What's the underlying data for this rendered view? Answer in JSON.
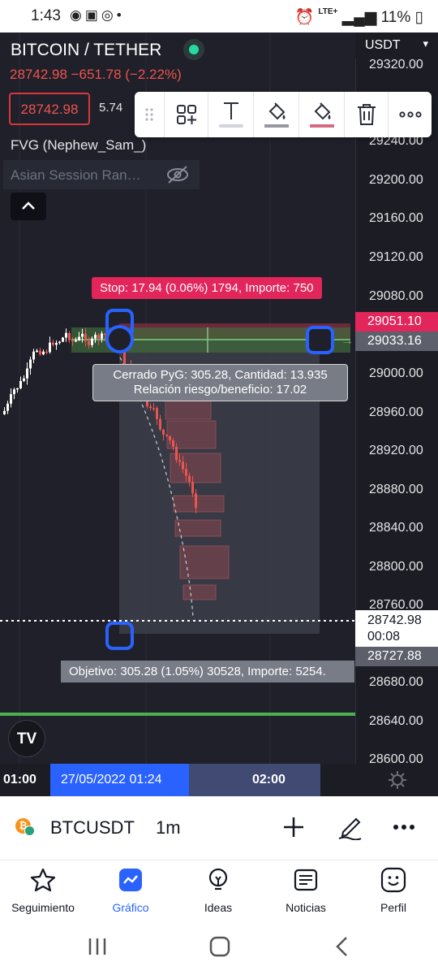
{
  "status_bar": {
    "time": "1:43",
    "network": "LTE+",
    "battery": "11%"
  },
  "chart": {
    "currency": "USDT",
    "pair_title": "BITCOIN / TETHER",
    "quote": "28742.98  −651.78 (−2.22%)",
    "sell_price": "28742.98",
    "spread": "5.74",
    "indicator_1": "FVG (Nephew_Sam_)",
    "indicator_2": "Asian Session Ran…",
    "price_ticks": [
      "29320.00",
      "29240.00",
      "29200.00",
      "29160.00",
      "29120.00",
      "29080.00",
      "29000.00",
      "28960.00",
      "28920.00",
      "28880.00",
      "28840.00",
      "28800.00",
      "28760.00",
      "28680.00",
      "28640.00",
      "28600.00"
    ],
    "stop_price_tag": "29051.10",
    "entry_price_tag": "29033.16",
    "last_price_tag": "28742.98",
    "countdown": "00:08",
    "target_price_tag": "28727.88",
    "stop_label": "Stop: 17.94 (0.06%) 1794, Importe: 750",
    "pnl_line_1": "Cerrado PyG: 305.28, Cantidad: 13.935",
    "pnl_line_2": "Relación riesgo/beneficio: 17.02",
    "target_label": "Objetivo: 305.28 (1.05%) 30528, Importe: 5254.",
    "logo": "TV",
    "time_axis": {
      "left": "01:00",
      "selected": "27/05/2022   01:24",
      "right": "02:00"
    }
  },
  "colors": {
    "chart_bg": "#1f2029",
    "accent": "#2962ff",
    "stop": "#e2255a",
    "bear": "#ef5350",
    "bull": "#ffffff",
    "target_line": "#4caf50"
  },
  "drawing_toolbar": {
    "icons": [
      "drag-handle-icon",
      "template-add-icon",
      "text-icon",
      "fill-color-icon",
      "line-color-icon",
      "delete-icon",
      "more-icon"
    ]
  },
  "symbol_bar": {
    "symbol": "BTCUSDT",
    "timeframe": "1m"
  },
  "bottom_nav": {
    "items": [
      {
        "label": "Seguimiento",
        "icon": "star-icon"
      },
      {
        "label": "Gráfico",
        "icon": "chart-icon"
      },
      {
        "label": "Ideas",
        "icon": "lightbulb-icon"
      },
      {
        "label": "Noticias",
        "icon": "news-icon"
      },
      {
        "label": "Perfil",
        "icon": "smiley-icon"
      }
    ]
  }
}
